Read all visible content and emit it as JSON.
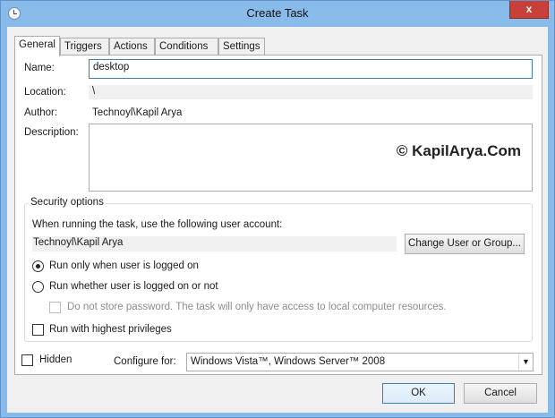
{
  "window": {
    "title": "Create Task",
    "close_label": "x"
  },
  "tabs": [
    {
      "label": "General"
    },
    {
      "label": "Triggers"
    },
    {
      "label": "Actions"
    },
    {
      "label": "Conditions"
    },
    {
      "label": "Settings"
    }
  ],
  "general": {
    "name_label": "Name:",
    "name_value": "desktop",
    "location_label": "Location:",
    "location_value": "\\",
    "author_label": "Author:",
    "author_value": "Technoyl\\Kapil Arya",
    "description_label": "Description:",
    "description_value": "",
    "watermark": "© KapilArya.Com"
  },
  "security": {
    "title": "Security options",
    "account_prompt": "When running the task, use the following user account:",
    "account_value": "Technoyl\\Kapil Arya",
    "change_button": "Change User or Group...",
    "radio_logged_on": "Run only when user is logged on",
    "radio_whether": "Run whether user is logged on or not",
    "no_store_password": "Do not store password.  The task will only have access to local computer resources.",
    "highest_privileges": "Run with highest privileges"
  },
  "bottom": {
    "hidden_label": "Hidden",
    "configure_label": "Configure for:",
    "configure_value": "Windows Vista™, Windows Server™ 2008"
  },
  "buttons": {
    "ok": "OK",
    "cancel": "Cancel"
  },
  "colors": {
    "titlebar": "#89bbea",
    "close": "#c7403a",
    "focus_border": "#3c7fb1"
  }
}
